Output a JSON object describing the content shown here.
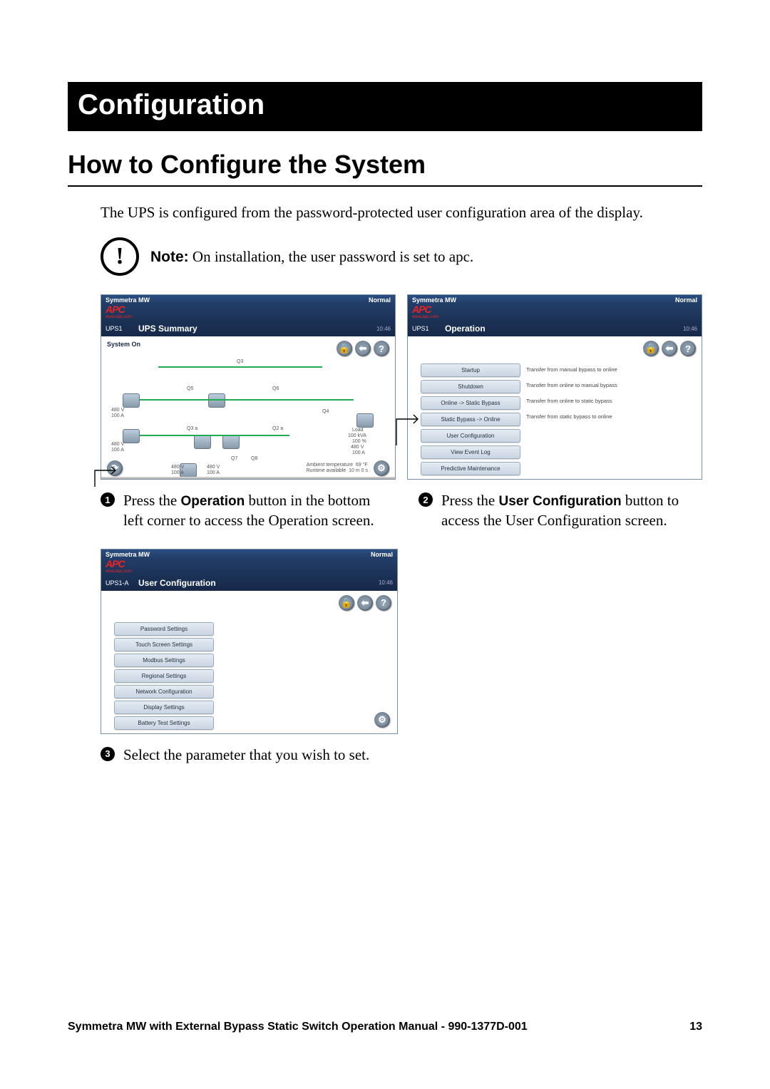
{
  "banner": "Configuration",
  "h1": "How to Configure the System",
  "intro": "The UPS is configured from the password-protected user configuration area of the display.",
  "note": {
    "label": "Note:",
    "text": "On installation, the user password is set to apc."
  },
  "screen_common": {
    "product": "Symmetra MW",
    "status": "Normal",
    "brand": "APC",
    "brand_url": "www.apc.com",
    "ups_id_1": "UPS1",
    "ups_id_2": "UPS1-A",
    "time": "10:46"
  },
  "screen1": {
    "title": "UPS Summary",
    "sidebar_label": "System On",
    "nodes": {
      "q3": "Q3",
      "q5": "Q5",
      "q6": "Q6",
      "q4": "Q4",
      "q3a": "Q3 a",
      "q2a": "Q2 a",
      "q7": "Q7",
      "q8": "Q8"
    },
    "readouts": {
      "left1_v": "480 V",
      "left1_a": "100 A",
      "left2_v": "480 V",
      "left2_a": "100 A",
      "mid1_v": "480 V",
      "mid1_a": "100 A",
      "mid2_v": "480 V",
      "mid2_a": "100 A",
      "load_lbl": "Load",
      "load_kva": "100 kVA",
      "load_pct": "100 %",
      "load_v": "480 V",
      "load_a": "100 A"
    },
    "footer": {
      "amb_lbl": "Ambient temperature",
      "amb_val": "69 °F",
      "rt_lbl": "Runtime available",
      "rt_val": "10 m  0 s"
    }
  },
  "screen2": {
    "title": "Operation",
    "buttons": [
      {
        "label": "Startup",
        "desc": "Transfer from manual bypass to online"
      },
      {
        "label": "Shutdown",
        "desc": "Transfer from online to manual bypass"
      },
      {
        "label": "Online -> Static Bypass",
        "desc": "Transfer from online to static bypass"
      },
      {
        "label": "Static Bypass -> Online",
        "desc": "Transfer from static bypass to online"
      },
      {
        "label": "User Configuration",
        "desc": ""
      },
      {
        "label": "View Event Log",
        "desc": ""
      },
      {
        "label": "Predictive Maintenance",
        "desc": ""
      }
    ]
  },
  "screen3": {
    "title": "User Configuration",
    "buttons": [
      "Password Settings",
      "Touch Screen Settings",
      "Modbus Settings",
      "Regional Settings",
      "Network Configuration",
      "Display Settings",
      "Battery Test Settings"
    ]
  },
  "steps": {
    "s1a": "Press the ",
    "s1b": "Operation",
    "s1c": " button in the bottom left corner to access the Operation screen.",
    "s2a": "Press the ",
    "s2b": "User Configuration",
    "s2c": " button to access the User Configuration screen.",
    "s3": "Select the parameter that you wish to set."
  },
  "icons": {
    "lock": "🔒",
    "back": "⬅",
    "help": "?",
    "gear": "⚙",
    "ops": "⟳"
  },
  "footer": {
    "title": "Symmetra MW with External Bypass Static Switch Operation Manual - 990-1377D-001",
    "page": "13"
  }
}
